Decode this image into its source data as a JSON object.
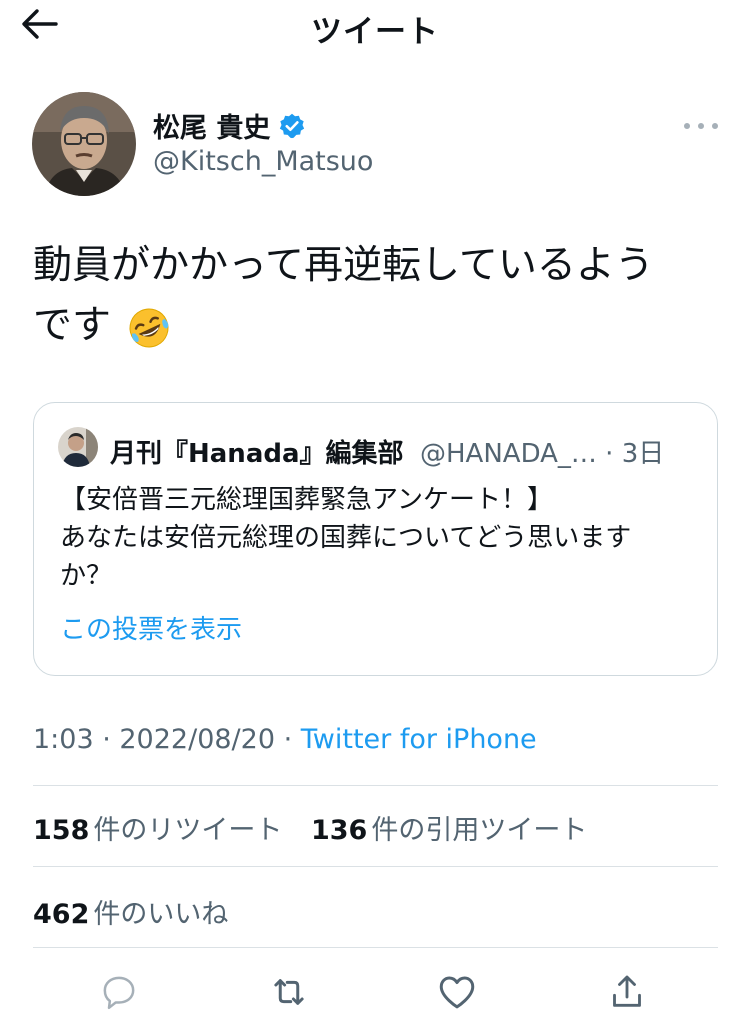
{
  "header": {
    "title": "ツイート",
    "back_icon": "arrow-left-icon"
  },
  "author": {
    "name": "松尾 貴史",
    "handle": "@Kitsch_Matsuo",
    "verified": true
  },
  "tweet": {
    "text_line1": "動員がかかって再逆転しているよう",
    "text_line2": "です"
  },
  "quote": {
    "name": "月刊『Hanada』編集部",
    "meta": "@HANADA_… · 3日",
    "text_lines": [
      "【安倍晋三元総理国葬緊急アンケート！】",
      "あなたは安倍元総理の国葬についてどう思います",
      "か？"
    ],
    "link": "この投票を表示"
  },
  "meta": {
    "time_date": "1:03 · 2022/08/20 · ",
    "source": "Twitter for iPhone"
  },
  "stats": {
    "retweets": "158",
    "retweets_label": "件のリツイート",
    "quotes": "136",
    "quotes_label": "件の引用ツイート",
    "likes": "462",
    "likes_label": "件のいいね"
  },
  "colors": {
    "accent": "#1d9bf0",
    "muted": "#536471",
    "border": "#cfd9de"
  },
  "icons": [
    "arrow-left-icon",
    "verified-badge-icon",
    "more-icon",
    "rofl-emoji",
    "reply-icon",
    "retweet-icon",
    "like-icon",
    "share-icon"
  ]
}
